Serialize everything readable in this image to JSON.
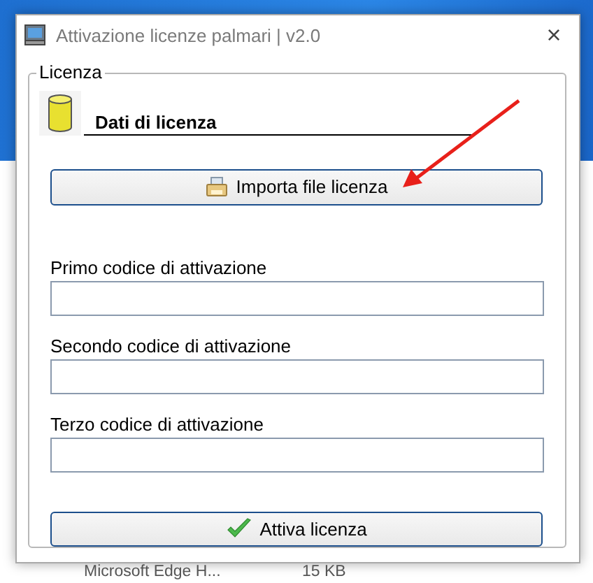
{
  "background": {
    "file_row": {
      "name": "Microsoft Edge H...",
      "size": "15 KB"
    }
  },
  "window": {
    "title": "Attivazione licenze palmari | v2.0",
    "close": "×"
  },
  "group": {
    "label": "Licenza",
    "header": "Dati di licenza",
    "import_button": "Importa file licenza",
    "fields": [
      {
        "label": "Primo codice di attivazione"
      },
      {
        "label": "Secondo codice di attivazione"
      },
      {
        "label": "Terzo codice di attivazione"
      }
    ],
    "activate_button": "Attiva licenza"
  }
}
